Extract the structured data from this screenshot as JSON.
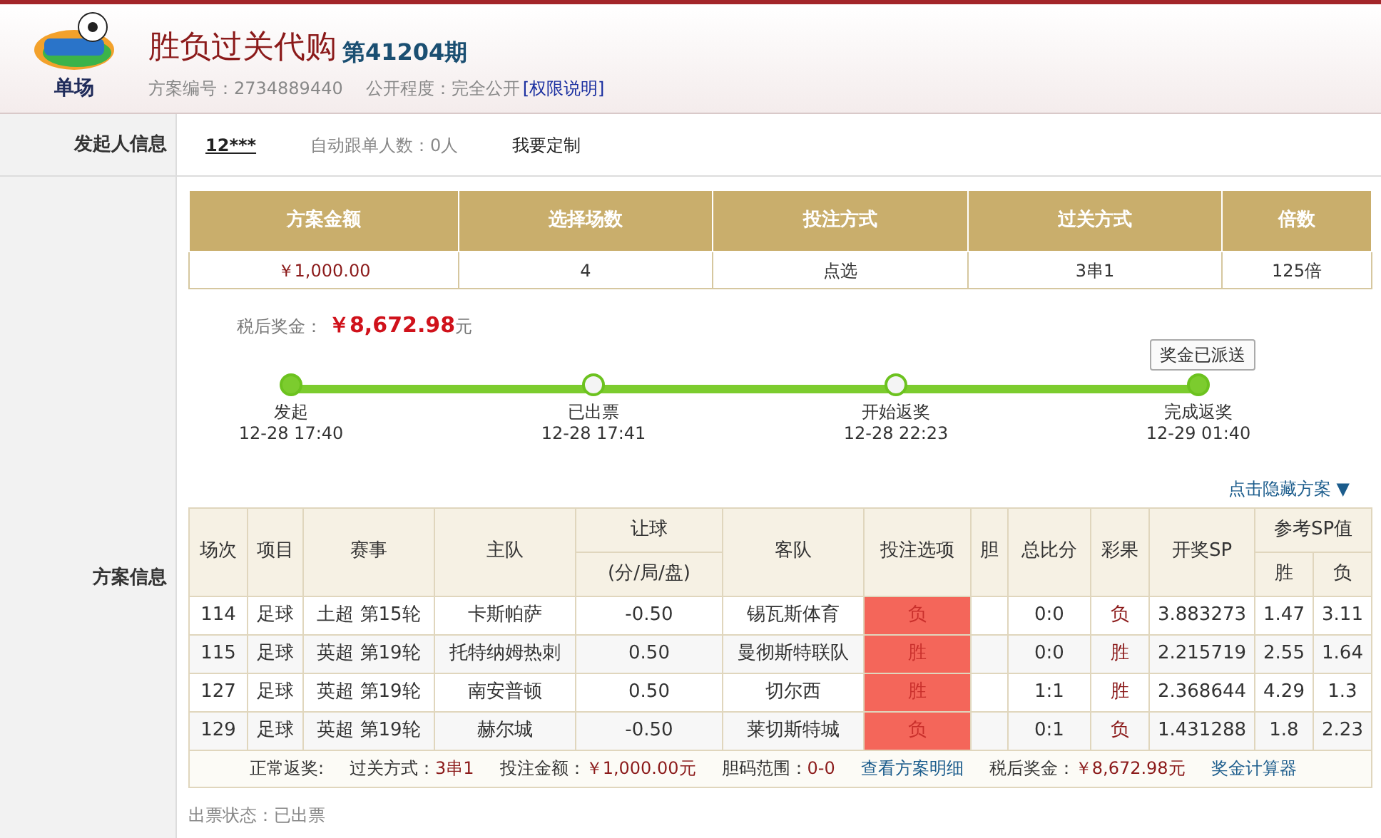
{
  "header": {
    "logo_text": "单场",
    "title": "胜负过关代购",
    "issue": "第41204期",
    "scheme_no_label": "方案编号：",
    "scheme_no": "2734889440",
    "visibility_label": "公开程度：",
    "visibility": "完全公开",
    "permission_link": "[权限说明]"
  },
  "initiator": {
    "label": "发起人信息",
    "name": "12***",
    "follow": "自动跟单人数：0人",
    "custom": "我要定制"
  },
  "plan": {
    "label": "方案信息",
    "summary": {
      "columns": [
        "方案金额",
        "选择场数",
        "投注方式",
        "过关方式",
        "倍数"
      ],
      "values": [
        "￥1,000.00",
        "4",
        "点选",
        "3串1",
        "125倍"
      ]
    },
    "prize_label": "税后奖金：",
    "prize": "￥8,672.98",
    "prize_unit": "元",
    "badge": "奖金已派送",
    "timeline": {
      "level": 1,
      "steps": [
        {
          "label": "发起",
          "time": "12-28 17:40",
          "filled": true
        },
        {
          "label": "已出票",
          "time": "12-28 17:41",
          "filled": false
        },
        {
          "label": "开始返奖",
          "time": "12-28 22:23",
          "filled": false
        },
        {
          "label": "完成返奖",
          "time": "12-29 01:40",
          "filled": true
        }
      ]
    },
    "hide_link": "点击隐藏方案 ▼",
    "table": {
      "header_rows": [
        [
          {
            "label": "场次",
            "rowspan": 2
          },
          {
            "label": "项目",
            "rowspan": 2
          },
          {
            "label": "赛事",
            "rowspan": 2
          },
          {
            "label": "主队",
            "rowspan": 2
          },
          {
            "label": "让球"
          },
          {
            "label": "客队",
            "rowspan": 2
          },
          {
            "label": "投注选项",
            "rowspan": 2
          },
          {
            "label": "胆",
            "rowspan": 2
          },
          {
            "label": "总比分",
            "rowspan": 2
          },
          {
            "label": "彩果",
            "rowspan": 2
          },
          {
            "label": "开奖SP",
            "rowspan": 2
          },
          {
            "label": "参考SP值",
            "colspan": 2
          }
        ],
        [
          {
            "label": "(分/局/盘)"
          },
          {
            "label": "胜"
          },
          {
            "label": "负"
          }
        ]
      ],
      "rows": [
        [
          "114",
          "足球",
          "土超 第15轮",
          "卡斯帕萨",
          "-0.50",
          "锡瓦斯体育",
          "负",
          "",
          "0:0",
          "负",
          "3.883273",
          "1.47",
          "3.11"
        ],
        [
          "115",
          "足球",
          "英超 第19轮",
          "托特纳姆热刺",
          "0.50",
          "曼彻斯特联队",
          "胜",
          "",
          "0:0",
          "胜",
          "2.215719",
          "2.55",
          "1.64"
        ],
        [
          "127",
          "足球",
          "英超 第19轮",
          "南安普顿",
          "0.50",
          "切尔西",
          "胜",
          "",
          "1:1",
          "胜",
          "2.368644",
          "4.29",
          "1.3"
        ],
        [
          "129",
          "足球",
          "英超 第19轮",
          "赫尔城",
          "-0.50",
          "莱切斯特城",
          "负",
          "",
          "0:1",
          "负",
          "1.431288",
          "1.8",
          "2.23"
        ]
      ]
    },
    "footer": [
      {
        "kind": "label",
        "text": "正常返奖:"
      },
      {
        "kind": "pair",
        "label": "过关方式：",
        "value": "3串1"
      },
      {
        "kind": "pair",
        "label": "投注金额：",
        "value": "￥1,000.00元"
      },
      {
        "kind": "pair",
        "label": "胆码范围：",
        "value": "0-0"
      },
      {
        "kind": "link",
        "text": "查看方案明细"
      },
      {
        "kind": "pair",
        "label": "税后奖金：",
        "value": "￥8,672.98元"
      },
      {
        "kind": "link",
        "text": "奖金计算器"
      }
    ],
    "ticket_status": "出票状态：已出票"
  }
}
